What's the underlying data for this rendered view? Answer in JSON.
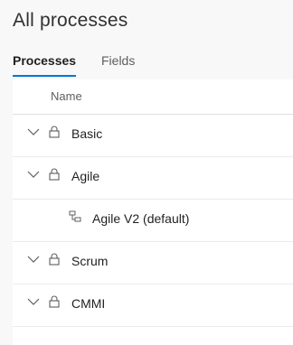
{
  "page": {
    "title": "All processes"
  },
  "tabs": [
    {
      "label": "Processes",
      "selected": true
    },
    {
      "label": "Fields",
      "selected": false
    }
  ],
  "table": {
    "column_name": "Name",
    "rows": [
      {
        "label": "Basic",
        "icon": "lock-icon",
        "expanded": true
      },
      {
        "label": "Agile",
        "icon": "lock-icon",
        "expanded": true
      },
      {
        "label": "Agile V2 (default)",
        "icon": "inherited-process-icon",
        "child": true
      },
      {
        "label": "Scrum",
        "icon": "lock-icon",
        "expanded": true
      },
      {
        "label": "CMMI",
        "icon": "lock-icon",
        "expanded": true
      }
    ]
  },
  "colors": {
    "accent": "#0078d4",
    "text": "#201f1e",
    "muted": "#605e5c"
  }
}
